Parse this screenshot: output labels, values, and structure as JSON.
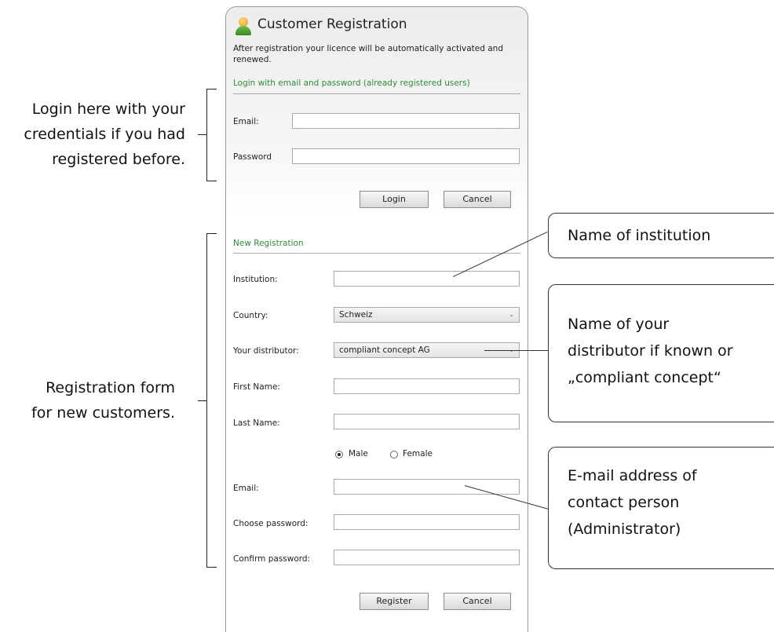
{
  "annotations": {
    "login_note": [
      "Login here with your",
      "credentials if you had",
      "registered before."
    ],
    "registration_note": [
      "Registration form",
      "for new customers."
    ]
  },
  "callouts": {
    "institution": [
      "Name of institution"
    ],
    "distributor": [
      "Name of your",
      "distributor if known or",
      "„compliant concept“"
    ],
    "email": [
      "E-mail address of",
      "contact person",
      "(Administrator)"
    ]
  },
  "dialog": {
    "title": "Customer Registration",
    "title_icon": "user-icon",
    "subtitle": "After registration your licence will be automatically activated and renewed.",
    "login_section": {
      "heading": "Login with email and password (already registered users)",
      "email_label": "Email:",
      "email_value": "",
      "password_label": "Password",
      "password_value": "",
      "login_button": "Login",
      "cancel_button": "Cancel"
    },
    "registration_section": {
      "heading": "New Registration",
      "institution_label": "Institution:",
      "institution_value": "",
      "country_label": "Country:",
      "country_value": "Schweiz",
      "distributor_label": "Your distributor:",
      "distributor_value": "compliant concept AG",
      "first_name_label": "First Name:",
      "first_name_value": "",
      "last_name_label": "Last Name:",
      "last_name_value": "",
      "gender_options": [
        "Male",
        "Female"
      ],
      "gender_selected": "Male",
      "email_label": "Email:",
      "email_value": "",
      "choose_password_label": "Choose password:",
      "confirm_password_label": "Confirm password:",
      "register_button": "Register",
      "cancel_button": "Cancel"
    }
  }
}
